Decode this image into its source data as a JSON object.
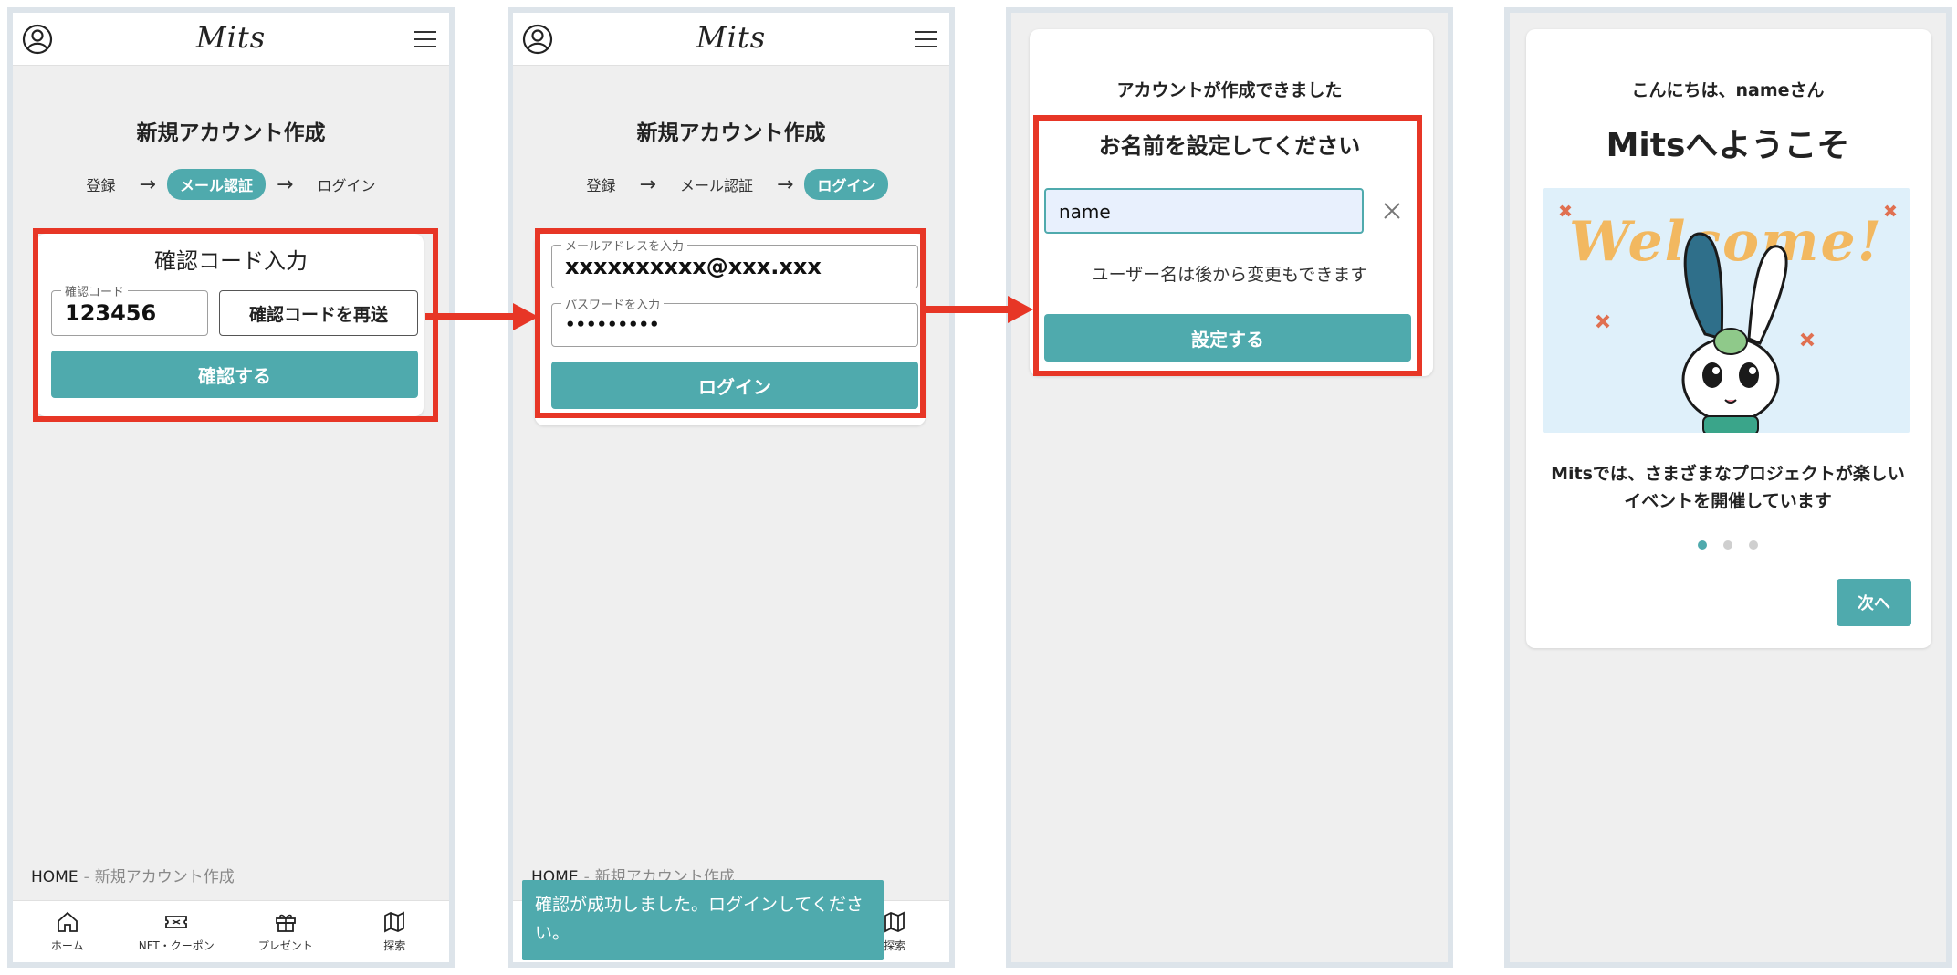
{
  "header": {
    "logo": "Mits"
  },
  "screen1": {
    "title": "新規アカウント作成",
    "steps": [
      "登録",
      "メール認証",
      "ログイン"
    ],
    "card_title": "確認コード入力",
    "code_label": "確認コード",
    "code_value": "123456",
    "resend_button": "確認コードを再送",
    "confirm_button": "確認する"
  },
  "screen2": {
    "title": "新規アカウント作成",
    "steps": [
      "登録",
      "メール認証",
      "ログイン"
    ],
    "email_label": "メールアドレスを入力",
    "email_value": "xxxxxxxxxx@xxx.xxx",
    "password_label": "パスワードを入力",
    "password_value": "•••••••••",
    "login_button": "ログイン",
    "toast": "確認が成功しました。ログインしてください。"
  },
  "screen3": {
    "heading": "アカウントが作成できました",
    "subheading": "お名前を設定してください",
    "name_value": "name",
    "hint": "ユーザー名は後から変更もできます",
    "set_button": "設定する"
  },
  "screen4": {
    "greeting": "こんにちは、nameさん",
    "welcome_title": "Mitsへようこそ",
    "welcome_art_text": "Welcome!",
    "description_line1": "Mitsでは、さまざまなプロジェクトが楽しい",
    "description_line2": "イベントを開催しています",
    "dots_count": 3,
    "active_dot": 1,
    "next_button": "次へ"
  },
  "breadcrumb": {
    "home": "HOME",
    "separator": "-",
    "current": "新規アカウント作成"
  },
  "bottom_nav": {
    "home": "ホーム",
    "nft": "NFT・クーポン",
    "present": "プレゼント",
    "explore": "探索"
  },
  "colors": {
    "accent": "#4faaad",
    "highlight": "#e73626",
    "screen_bg": "#efefef",
    "frame": "#dde4ea"
  }
}
